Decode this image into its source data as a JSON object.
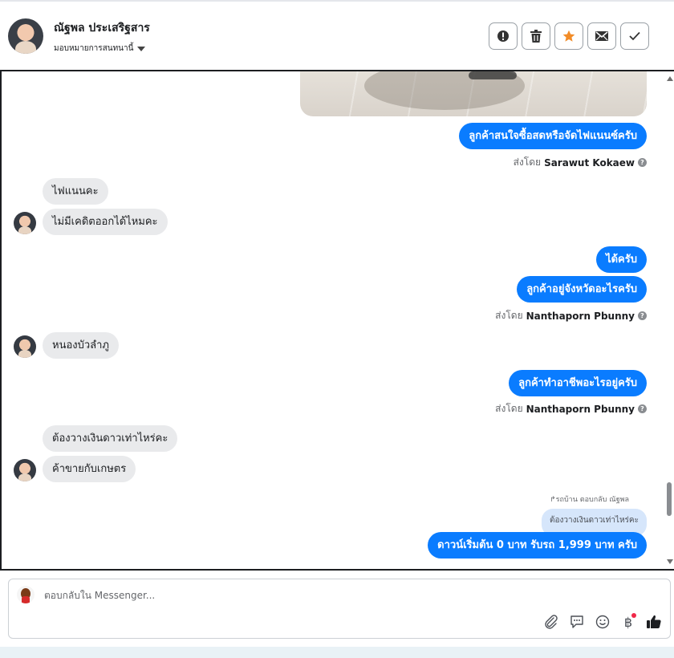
{
  "header": {
    "name": "ณัฐพล ประเสริฐสาร",
    "assign_label": "มอบหมายการสนทนานี้"
  },
  "messages": {
    "m1": "ลูกค้าสนใจซื้อสดหรือจัดไฟแนนซ์ครับ",
    "sent1_prefix": "ส่งโดย",
    "sent1_name": "Sarawut Kokaew",
    "m2": "ไฟแนนคะ",
    "m3": "ไม่มีเคดิตออกได้ไหมคะ",
    "m4": "ได้ครับ",
    "m5": "ลูกค้าอยู่จังหวัดอะไรครับ",
    "sent2_prefix": "ส่งโดย",
    "sent2_name": "Nanthaporn Pbunny",
    "m6": "หนองบัวลำภู",
    "m7": "ลูกค้าทำอาชีพอะไรอยู่ครับ",
    "sent3_prefix": "ส่งโดย",
    "sent3_name": "Nanthaporn Pbunny",
    "m8": "ต้องวางเงินดาวเท่าไหร่คะ",
    "m9": "ค้าขายกับเกษตร",
    "reply_hint": "รถบ้าน ตอบกลับ ณัฐพล",
    "quoted": "ต้องวางเงินดาวเท่าไหร่คะ",
    "m10": "ดาวน์เริ่มต้น 0 บาท รับรถ 1,999 บาท ครับ"
  },
  "composer": {
    "placeholder": "ตอบกลับใน Messenger..."
  },
  "icons": {
    "actions": [
      "alert-icon",
      "trash-icon",
      "star-icon",
      "mail-icon",
      "check-icon"
    ],
    "tools": [
      "paperclip-icon",
      "saved-reply-icon",
      "emoji-icon",
      "baht-icon",
      "thumbs-up-icon"
    ],
    "star_color": "#f28c28",
    "bubble_out_color": "#0a7cff",
    "bubble_in_color": "#e9eaec"
  }
}
